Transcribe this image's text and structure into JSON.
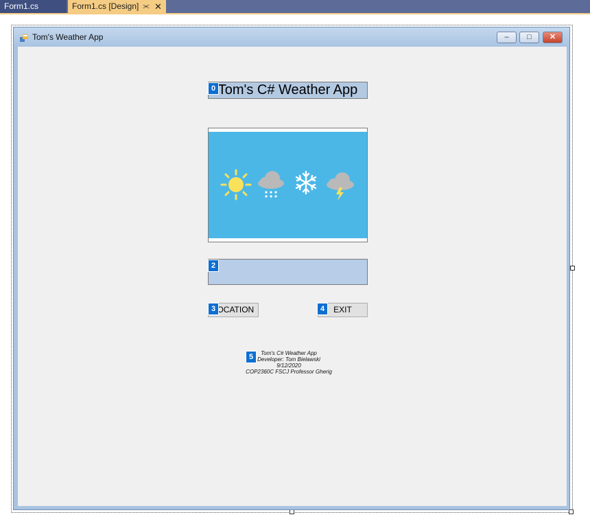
{
  "tabs": [
    {
      "label": "Form1.cs",
      "active": false
    },
    {
      "label": "Form1.cs [Design]",
      "active": true
    }
  ],
  "tab_pin_icon": "⫘",
  "tab_close_icon": "✕",
  "form": {
    "title": "Tom's Weather App",
    "minimize_glyph": "–",
    "maximize_glyph": "□",
    "close_glyph": "✕"
  },
  "controls": {
    "title_label": "Tom's C# Weather App",
    "location_button": "LOCATION",
    "exit_button": "EXIT",
    "info_lines": [
      "Tom's C# Weather App",
      "Developer: Tom Bielawski",
      "9/12/2020",
      "COP2360C FSCJ Professor Gherig"
    ]
  },
  "tab_order_tags": [
    "0",
    "2",
    "3",
    "4",
    "5"
  ],
  "colors": {
    "sky": "#4bb7e7",
    "sun": "#f9e15a",
    "cloud": "#b9b9b9",
    "tag": "#0c6fd1"
  }
}
